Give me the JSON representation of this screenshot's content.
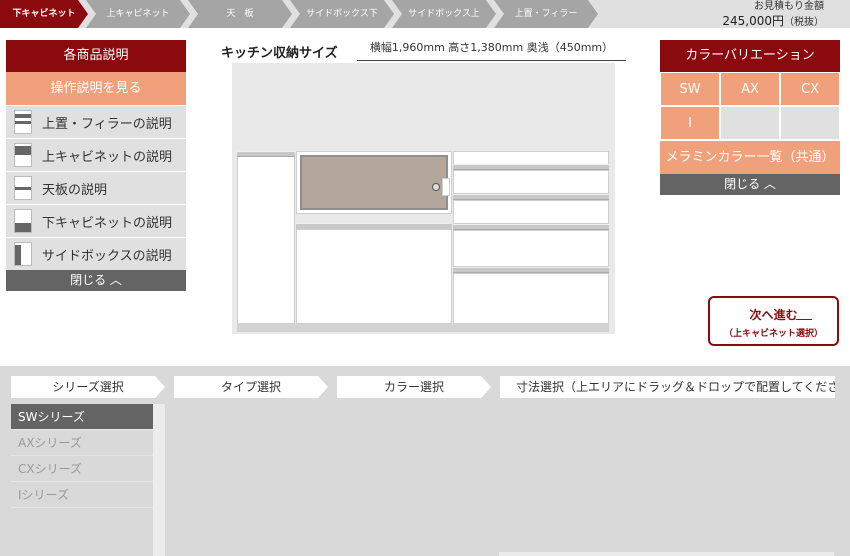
{
  "steps": [
    "下キャビネット",
    "上キャビネット",
    "天　板",
    "サイドボックス下",
    "サイドボックス上",
    "上置・フィラー"
  ],
  "estimate": {
    "label": "お見積もり金額",
    "amount": "245,000円",
    "tax": "（税抜）"
  },
  "left_panel": {
    "title": "各商品説明",
    "manual": "操作説明を見る",
    "items": [
      "上置・フィラーの説明",
      "上キャビネットの説明",
      "天板の説明",
      "下キャビネットの説明",
      "サイドボックスの説明"
    ],
    "close": "閉じる ︿"
  },
  "center": {
    "title": "キッチン収納サイズ",
    "size": "横幅1,960mm  高さ1,380mm  奥浅（450mm）"
  },
  "right_panel": {
    "title": "カラーバリエーション",
    "colors": [
      "SW",
      "AX",
      "CX",
      "I"
    ],
    "list": "メラミンカラー一覧（共通）",
    "close": "閉じる ︿"
  },
  "next_button": {
    "label": "次へ進む",
    "sub": "（上キャビネット選択）"
  },
  "tabs": [
    "シリーズ選択",
    "タイプ選択",
    "カラー選択",
    "寸法選択（上エリアにドラッグ＆ドロップで配置してください）"
  ],
  "series": [
    "SWシリーズ",
    "AXシリーズ",
    "CXシリーズ",
    "Iシリーズ"
  ],
  "accent": "#8b0a0e",
  "salmon": "#f0a17b"
}
